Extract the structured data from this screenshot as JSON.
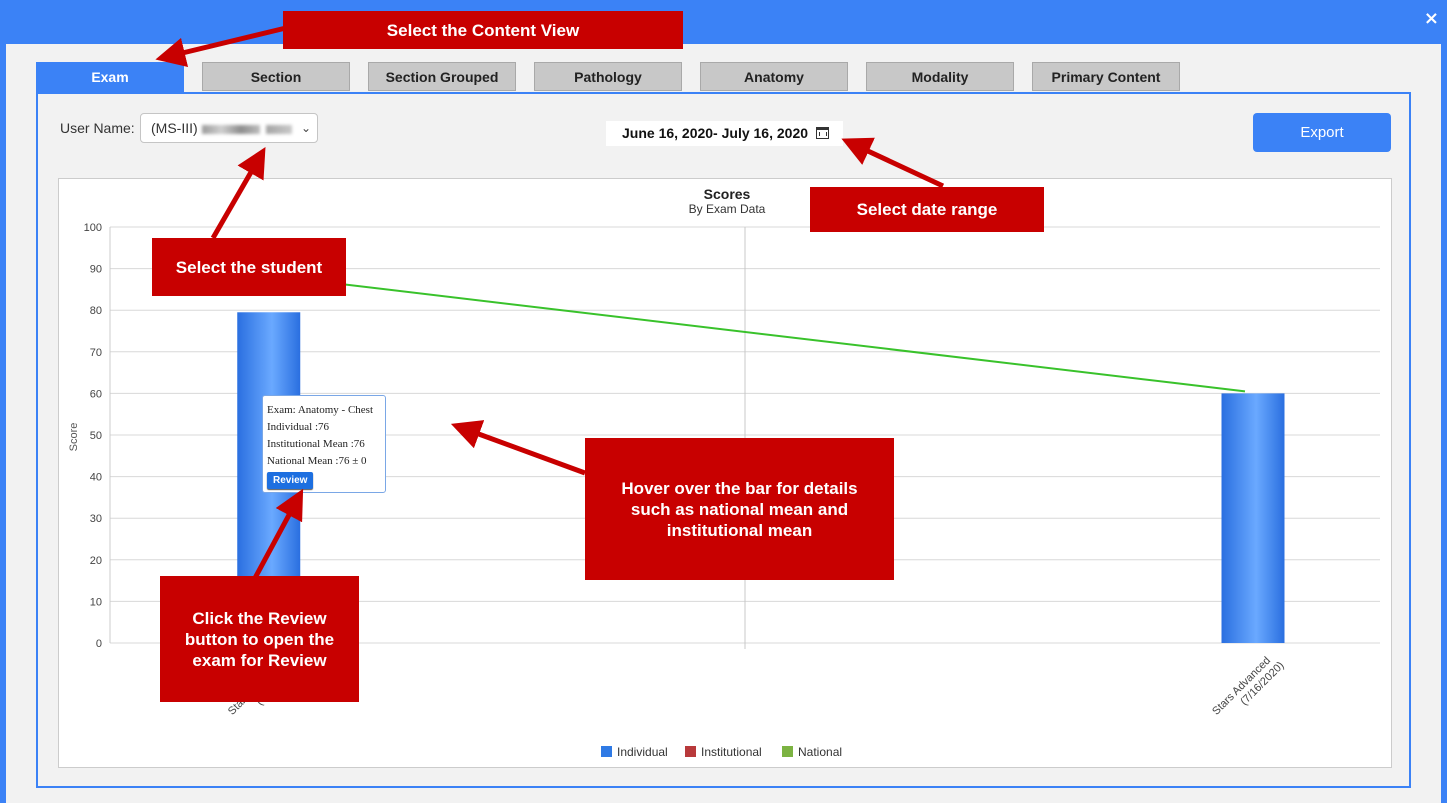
{
  "window": {
    "close_label": "×"
  },
  "tabs": [
    {
      "label": "Exam",
      "active": true
    },
    {
      "label": "Section"
    },
    {
      "label": "Section Grouped"
    },
    {
      "label": "Pathology"
    },
    {
      "label": "Anatomy"
    },
    {
      "label": "Modality"
    },
    {
      "label": "Primary Content"
    }
  ],
  "filters": {
    "user_label": "User Name:",
    "user_value": "(MS-III)",
    "date_range": "June 16, 2020- July 16, 2020",
    "export_label": "Export"
  },
  "chart_data": {
    "type": "bar",
    "title": "Scores",
    "subtitle": "By Exam Data",
    "ylabel": "Score",
    "ylim": [
      0,
      100
    ],
    "yticks": [
      0,
      10,
      20,
      30,
      40,
      50,
      60,
      70,
      80,
      90,
      100
    ],
    "categories": [
      "Stars Advanced (7/16/2020)",
      "Stars Advanced (7/16/2020)"
    ],
    "category_lines": [
      [
        "Stars Advanced",
        "(7/16/2020)"
      ],
      [
        "Stars Advanced",
        "(7/16/2020)"
      ]
    ],
    "series": [
      {
        "name": "Individual",
        "type": "bar",
        "values": [
          79.5,
          60
        ],
        "color": "#3b82f6"
      },
      {
        "name": "National",
        "type": "line",
        "values": [
          88.5,
          60.5
        ],
        "color": "#39c22b"
      }
    ],
    "legend": [
      {
        "name": "Individual",
        "color": "#2f7ae5"
      },
      {
        "name": "Institutional",
        "color": "#b8393b"
      },
      {
        "name": "National",
        "color": "#7cb342"
      }
    ],
    "legend_position": "bottom",
    "grid": true
  },
  "tooltip": {
    "exam": "Exam: Anatomy - Chest",
    "individual": "Individual :76",
    "institutional": "Institutional Mean :76",
    "national": "National Mean :76 ± 0",
    "review_label": "Review"
  },
  "annotations": {
    "content_view": "Select the Content View",
    "student": "Select the student",
    "date_range": "Select date range",
    "hover": "Hover over the bar for details such as national mean and institutional mean",
    "review": "Click the Review button to open the exam for Review"
  },
  "colors": {
    "accent": "#3b82f6",
    "annotation": "#c80000",
    "national_line": "#39c22b"
  }
}
